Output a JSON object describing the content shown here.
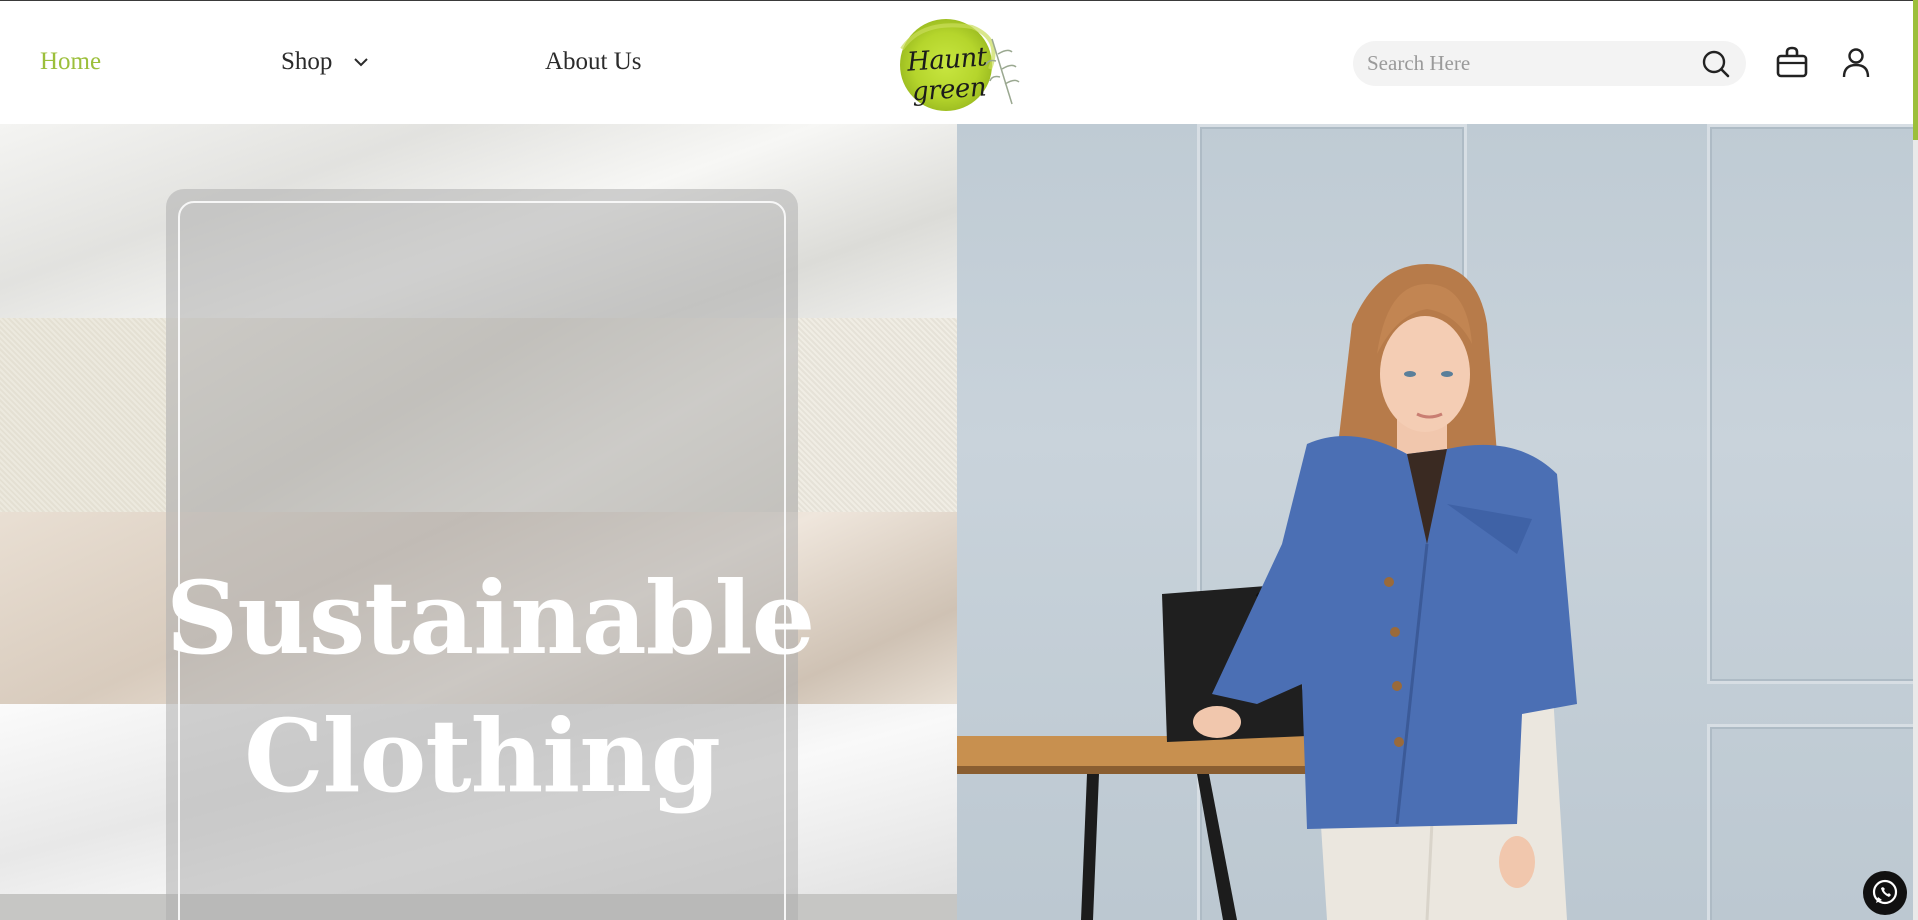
{
  "nav": {
    "home_label": "Home",
    "shop_label": "Shop",
    "about_label": "About Us"
  },
  "logo": {
    "text": "Haunt green"
  },
  "search": {
    "placeholder": "Search Here",
    "value": ""
  },
  "hero": {
    "title_line1": "Sustainable",
    "title_line2": "Clothing"
  },
  "colors": {
    "accent": "#9cbf3b",
    "text": "#2b2b2b",
    "search_bg": "#f3f3f3",
    "whatsapp_bg": "#111111"
  },
  "icons": {
    "shop_dropdown": "chevron-down-icon",
    "search": "search-icon",
    "cart": "shopping-bag-icon",
    "account": "user-icon",
    "chat": "whatsapp-icon"
  }
}
